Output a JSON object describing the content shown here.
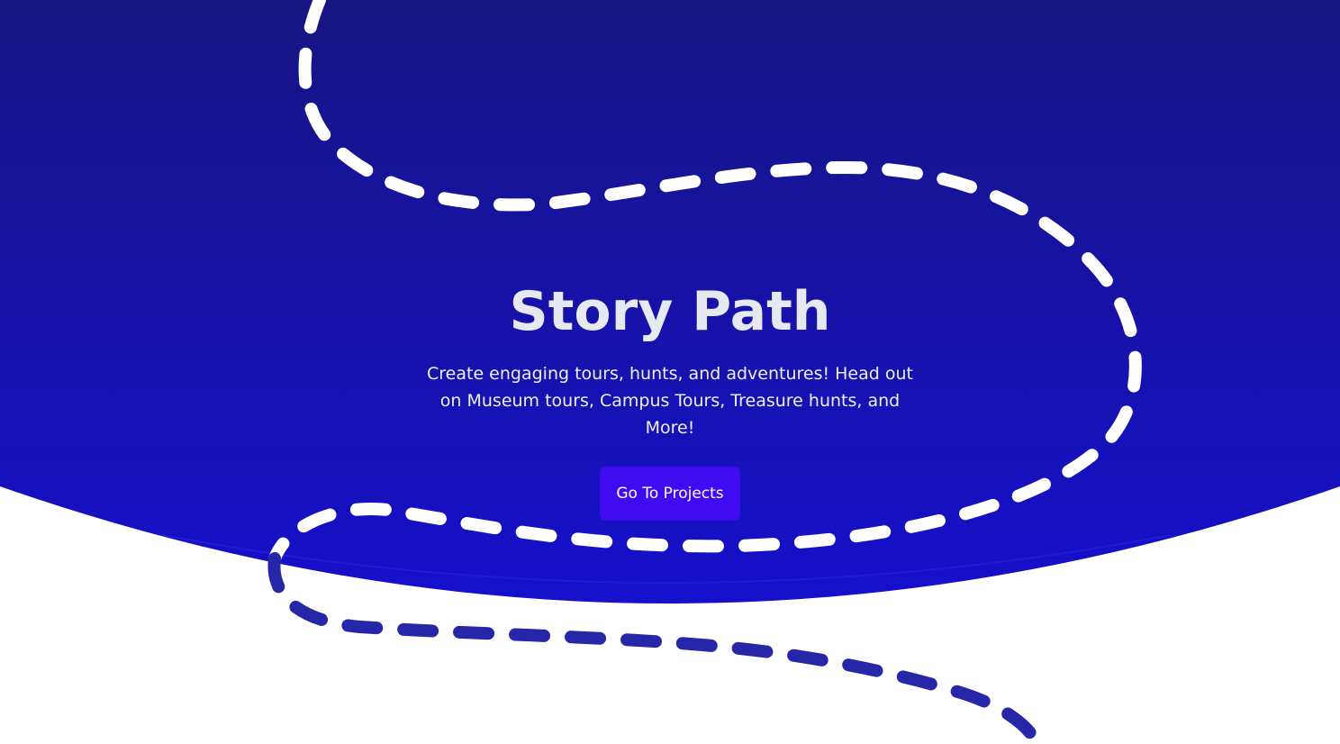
{
  "hero": {
    "title": "Story Path",
    "subtitle": "Create engaging tours, hunts, and adventures! Head out on Museum tours, Campus Tours, Treasure hunts, and More!",
    "cta_label": "Go To Projects"
  },
  "colors": {
    "hero_gradient_top": "#161582",
    "hero_gradient_bottom": "#1510cc",
    "button": "#3f0cf2",
    "path_light": "#ffffff",
    "path_dark": "#2626a8",
    "title": "#e6e8f2"
  },
  "decorations": {
    "path_icon": "dashed-trail-path"
  }
}
